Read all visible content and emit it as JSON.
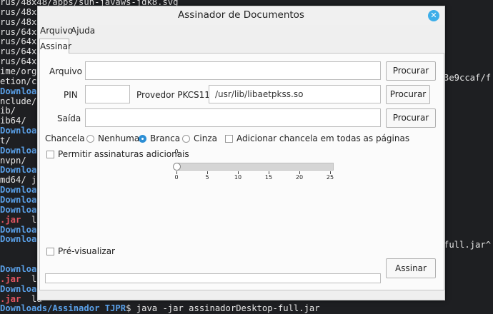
{
  "terminal": {
    "left_lines": [
      {
        "text": "rus/48x48/apps/sun-javaws-jdk8.svg",
        "style": "plain"
      },
      {
        "text": "rus/48x4",
        "style": "plain"
      },
      {
        "text": "rus/48x4",
        "style": "plain"
      },
      {
        "text": "rus/64x6",
        "style": "plain"
      },
      {
        "text": "rus/64x6",
        "style": "plain"
      },
      {
        "text": "rus/64x6",
        "style": "plain"
      },
      {
        "text": "rus/64x6",
        "style": "plain"
      },
      {
        "text": "ime/org.",
        "style": "plain"
      },
      {
        "text": "etion/co",
        "style": "plain"
      },
      {
        "text": "Download",
        "style": "blue"
      },
      {
        "text": "nclude/",
        "style": "plain"
      },
      {
        "text": "ib/",
        "style": "plain"
      },
      {
        "text": "ib64/",
        "style": "plain"
      },
      {
        "text": "Download",
        "style": "blue"
      },
      {
        "text": "t/",
        "style": "plain"
      },
      {
        "text": "Download",
        "style": "blue"
      },
      {
        "text": "nvpn/",
        "style": "plain"
      },
      {
        "text": "Download",
        "style": "blue"
      },
      {
        "text": "md64/ ja",
        "style": "plain"
      },
      {
        "text": "Download",
        "style": "blue"
      },
      {
        "text": "Download",
        "style": "blue"
      },
      {
        "text": "Download",
        "style": "blue"
      },
      {
        "text": ".jar",
        "style": "red",
        "rest": "  la"
      },
      {
        "text": "Download",
        "style": "blue"
      },
      {
        "text": "Download",
        "style": "blue"
      },
      {
        "text": "",
        "style": "plain"
      },
      {
        "text": "",
        "style": "plain"
      },
      {
        "text": "Download",
        "style": "blue"
      },
      {
        "text": ".jar",
        "style": "red",
        "rest": "  la"
      },
      {
        "text": "Download",
        "style": "blue"
      },
      {
        "text": ".jar",
        "style": "red",
        "rest": "  la"
      },
      {
        "text": "Downloads/Assinador TJPR",
        "style": "blue",
        "rest": "$ java -jar assinadorDesktop-full.jar"
      }
    ],
    "right_1": "3e9ccaf/f",
    "right_2": "full.jar^"
  },
  "window": {
    "title": "Assinador de Documentos",
    "close_symbol": "✕"
  },
  "menu": {
    "arquivo": "Arquivo",
    "ajuda": "Ajuda"
  },
  "tab": {
    "assinar": "Assinar"
  },
  "form": {
    "arquivo_label": "Arquivo",
    "arquivo_value": "",
    "pin_label": "PIN",
    "pin_value": "",
    "provedor_label": "Provedor PKCS11",
    "provedor_value": "/usr/lib/libaetpkss.so",
    "saida_label": "Saída",
    "saida_value": "",
    "procurar_label": "Procurar",
    "chancela_label": "Chancela",
    "radio_nenhuma": "Nenhuma",
    "radio_branca": "Branca",
    "radio_cinza": "Cinza",
    "selected_chancela": "Branca",
    "check_todas": "Adicionar chancela em todas as páginas",
    "check_permitir": "Permitir assinaturas adicionais",
    "slider_value_label": "0",
    "slider_ticks": [
      "0",
      "5",
      "10",
      "15",
      "20",
      "25"
    ],
    "slider_value": 0,
    "slider_max": 25,
    "previsualizar": "Pré-visualizar",
    "assinar_button": "Assinar",
    "progress_fraction": 0.0
  },
  "colors": {
    "accent": "#3daee9",
    "terminal_bg": "#1e1f22",
    "dir_blue": "#5aa0e8",
    "jar_red": "#e05561"
  }
}
